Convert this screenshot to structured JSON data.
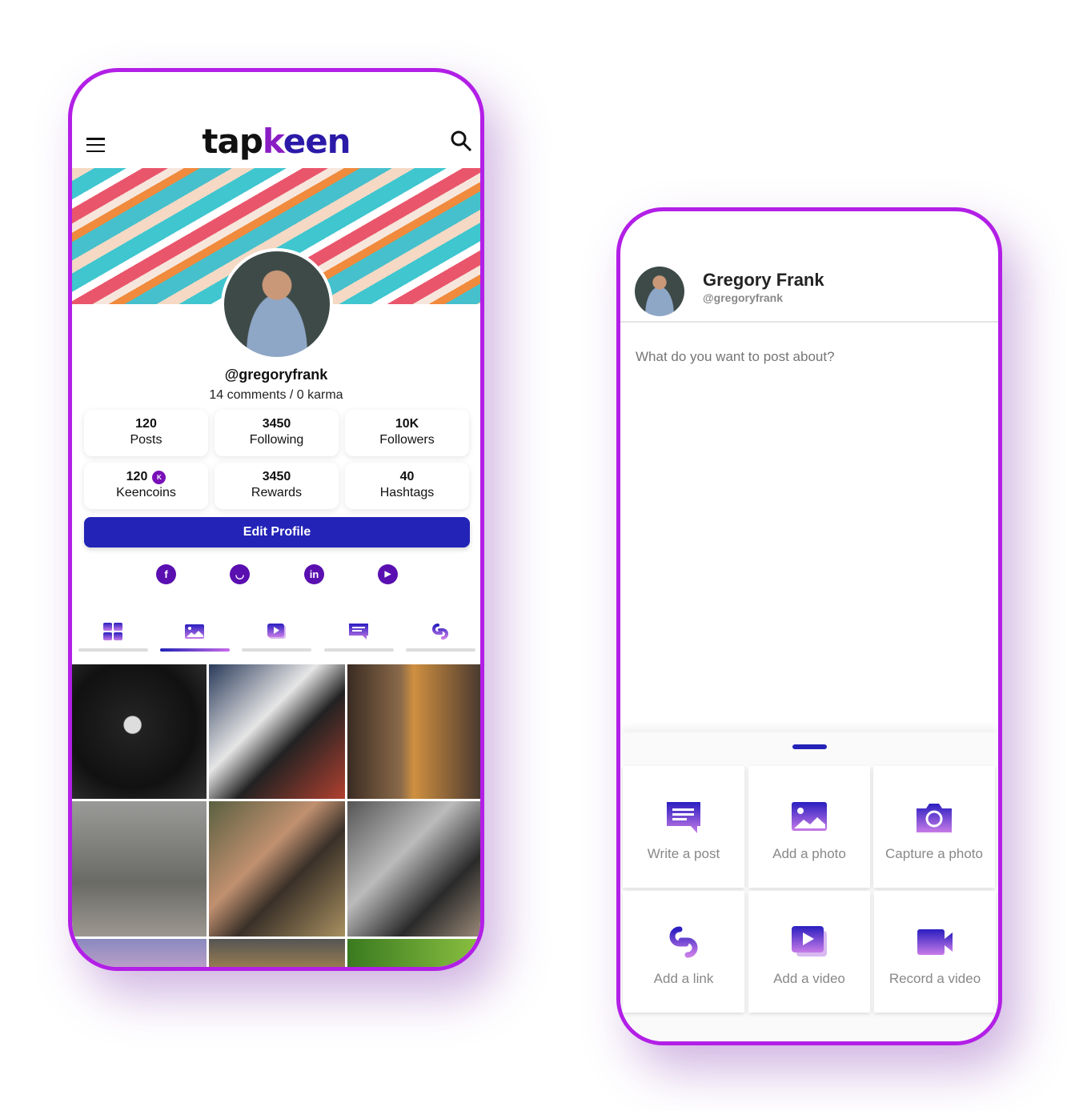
{
  "profile_screen": {
    "logo": {
      "part1": "tap",
      "part2": "k",
      "part3": "een"
    },
    "handle": "@gregoryfrank",
    "summary": "14 comments / 0 karma",
    "stats": [
      {
        "value": "120",
        "label": "Posts"
      },
      {
        "value": "3450",
        "label": "Following"
      },
      {
        "value": "10K",
        "label": "Followers"
      },
      {
        "value": "120",
        "label": "Keencoins",
        "badge": "K"
      },
      {
        "value": "3450",
        "label": "Rewards"
      },
      {
        "value": "40",
        "label": "Hashtags"
      }
    ],
    "edit_profile_label": "Edit Profile",
    "social": [
      {
        "icon": "facebook-icon",
        "glyph": "f"
      },
      {
        "icon": "reddit-icon",
        "glyph": "◡"
      },
      {
        "icon": "linkedin-icon",
        "glyph": "in"
      },
      {
        "icon": "youtube-icon",
        "glyph": "▶"
      }
    ],
    "tabs": [
      "grid-icon",
      "photo-icon",
      "video-icon",
      "post-icon",
      "link-icon"
    ],
    "active_tab": 1,
    "accent": "#2323b8",
    "frame_color": "#b21fe6"
  },
  "compose_screen": {
    "name": "Gregory Frank",
    "username": "@gregoryfrank",
    "placeholder": "What do you want to post about?",
    "actions": [
      {
        "label": "Write a post",
        "icon": "message-icon"
      },
      {
        "label": "Add a photo",
        "icon": "image-icon"
      },
      {
        "label": "Capture a photo",
        "icon": "camera-icon"
      },
      {
        "label": "Add a link",
        "icon": "link-icon"
      },
      {
        "label": "Add a video",
        "icon": "video-icon"
      },
      {
        "label": "Record a video",
        "icon": "video-camera-icon"
      }
    ]
  }
}
